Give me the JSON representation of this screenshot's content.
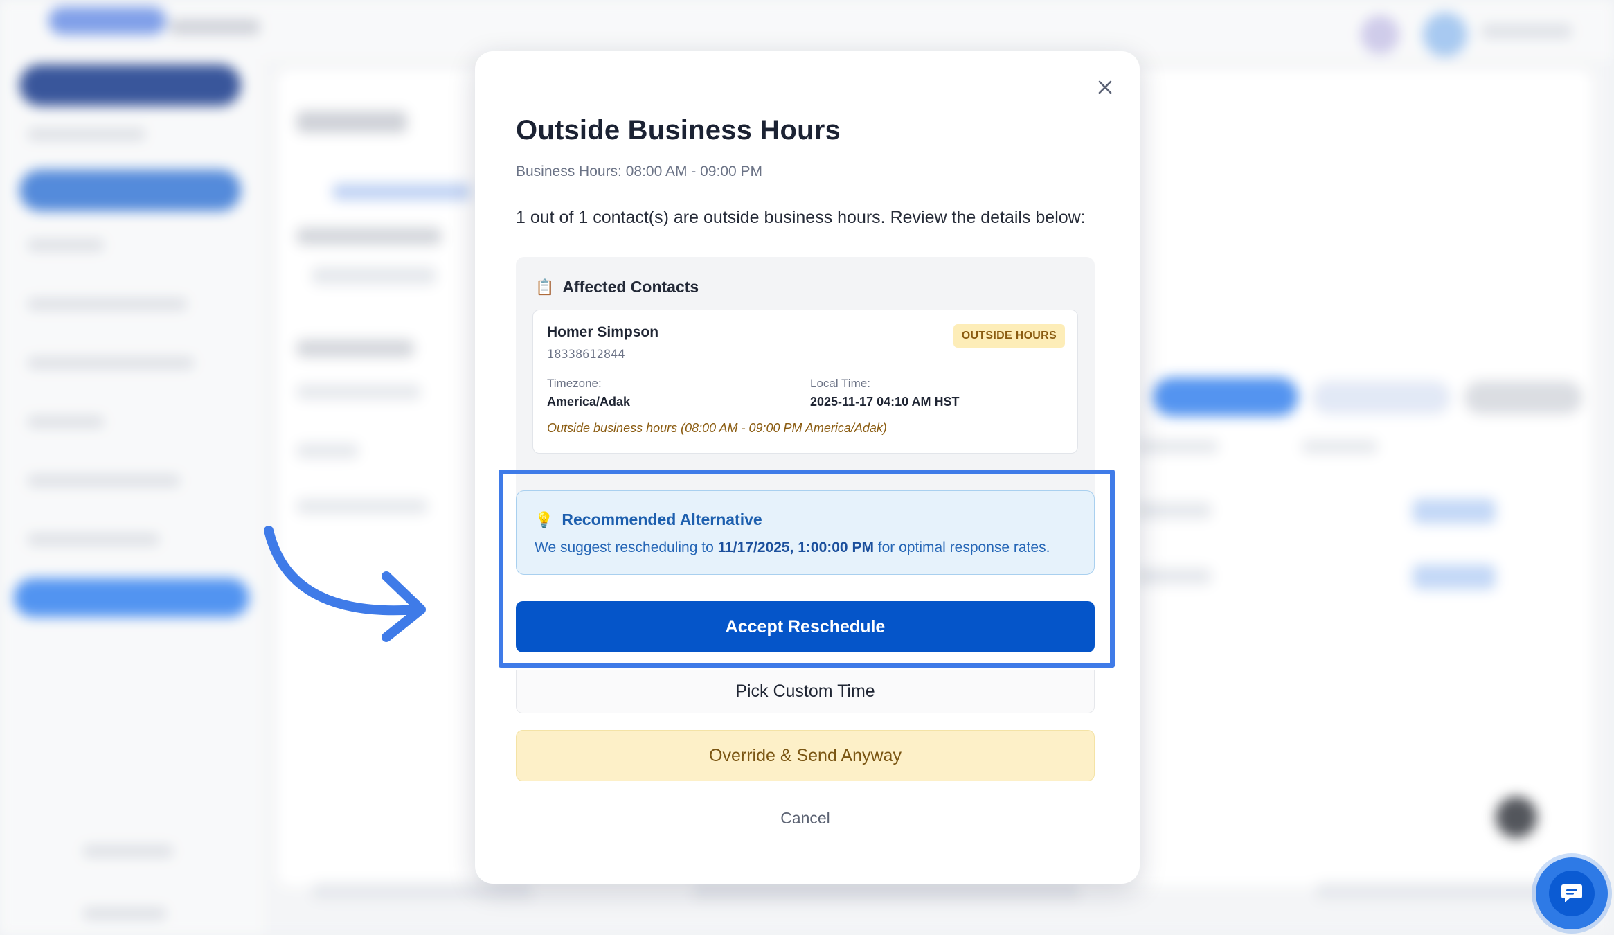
{
  "modal": {
    "title": "Outside Business Hours",
    "business_hours": "Business Hours: 08:00 AM - 09:00 PM",
    "summary": "1 out of 1 contact(s) are outside business hours. Review the details below:",
    "affected_title": "Affected Contacts",
    "affected_icon": "clipboard-icon",
    "contact": {
      "name": "Homer Simpson",
      "phone": "18338612844",
      "badge": "OUTSIDE HOURS",
      "timezone_label": "Timezone:",
      "timezone_value": "America/Adak",
      "local_time_label": "Local Time:",
      "local_time_value": "2025-11-17 04:10 AM HST",
      "note": "Outside business hours (08:00 AM - 09:00 PM America/Adak)"
    },
    "recommend": {
      "icon": "lightbulb-icon",
      "title": "Recommended Alternative",
      "text_before": "We suggest rescheduling to ",
      "datetime": "11/17/2025, 1:00:00 PM",
      "text_after": " for optimal response rates."
    },
    "buttons": {
      "accept": "Accept Reschedule",
      "custom": "Pick Custom Time",
      "override": "Override & Send Anyway",
      "cancel": "Cancel"
    }
  },
  "colors": {
    "primary": "#0555c9",
    "highlight_frame": "#3f7be8",
    "badge_bg": "#fdedb8",
    "override_bg": "#fdf0c8",
    "recommend_bg": "#e6f2fb"
  }
}
